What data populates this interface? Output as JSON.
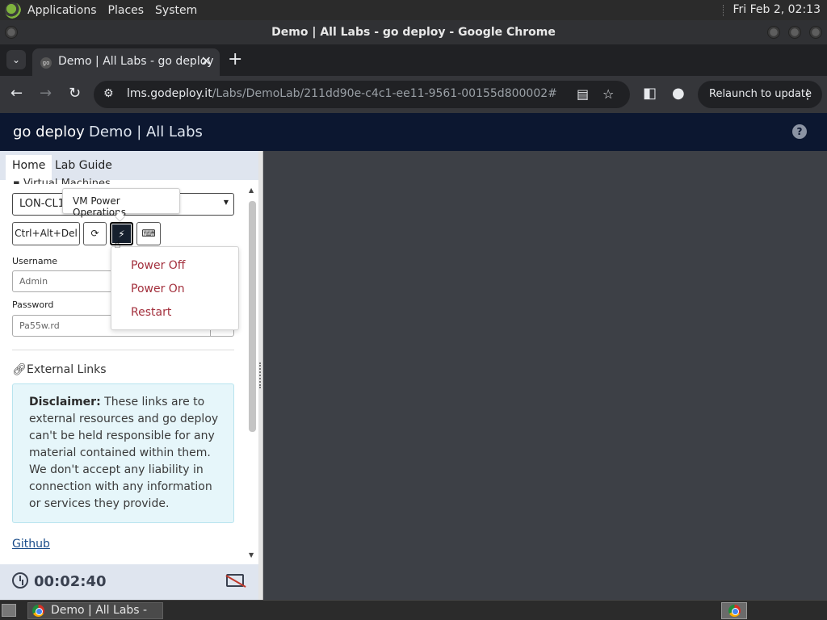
{
  "os_panel": {
    "menus": [
      "Applications",
      "Places",
      "System"
    ],
    "clock": "Fri Feb  2, 02:13"
  },
  "window": {
    "title": "Demo | All Labs - go deploy - Google Chrome"
  },
  "browser": {
    "tab_title": "Demo | All Labs - go deploy",
    "tab_favicon_text": "go",
    "url_host": "lms.godeploy.it",
    "url_path": "/Labs/DemoLab/211dd90e-c4c1-ee11-9561-00155d800002#",
    "relaunch_label": "Relaunch to update"
  },
  "app": {
    "brand": "go deploy",
    "breadcrumb": "Demo | All Labs",
    "help_label": "?"
  },
  "sidebar": {
    "tabs": [
      "Home",
      "Lab Guide"
    ],
    "section_partial": "Virtual Machines",
    "vm_select_value": "LON-CL1",
    "buttons": {
      "ctrl_alt_del": "Ctrl+Alt+Del"
    },
    "tooltip": "VM Power Operations",
    "power_menu": [
      "Power Off",
      "Power On",
      "Restart"
    ],
    "username_label": "Username",
    "username_value": "Admin",
    "password_label": "Password",
    "password_value": "Pa55w.rd",
    "external_links_heading": "External Links",
    "disclaimer_bold": "Disclaimer:",
    "disclaimer_text": " These links are to external resources and go deploy can't be held responsible for any material contained within them. We don't accept any liability in connection with any information or services they provide.",
    "github_link": "Github",
    "timer": "00:02:40"
  },
  "taskbar": {
    "task_label": "Demo | All Labs - go..."
  },
  "colors": {
    "header_bg": "#0c1730",
    "power_item": "#a3303d",
    "disclaimer_bg": "#e6f6fa"
  }
}
